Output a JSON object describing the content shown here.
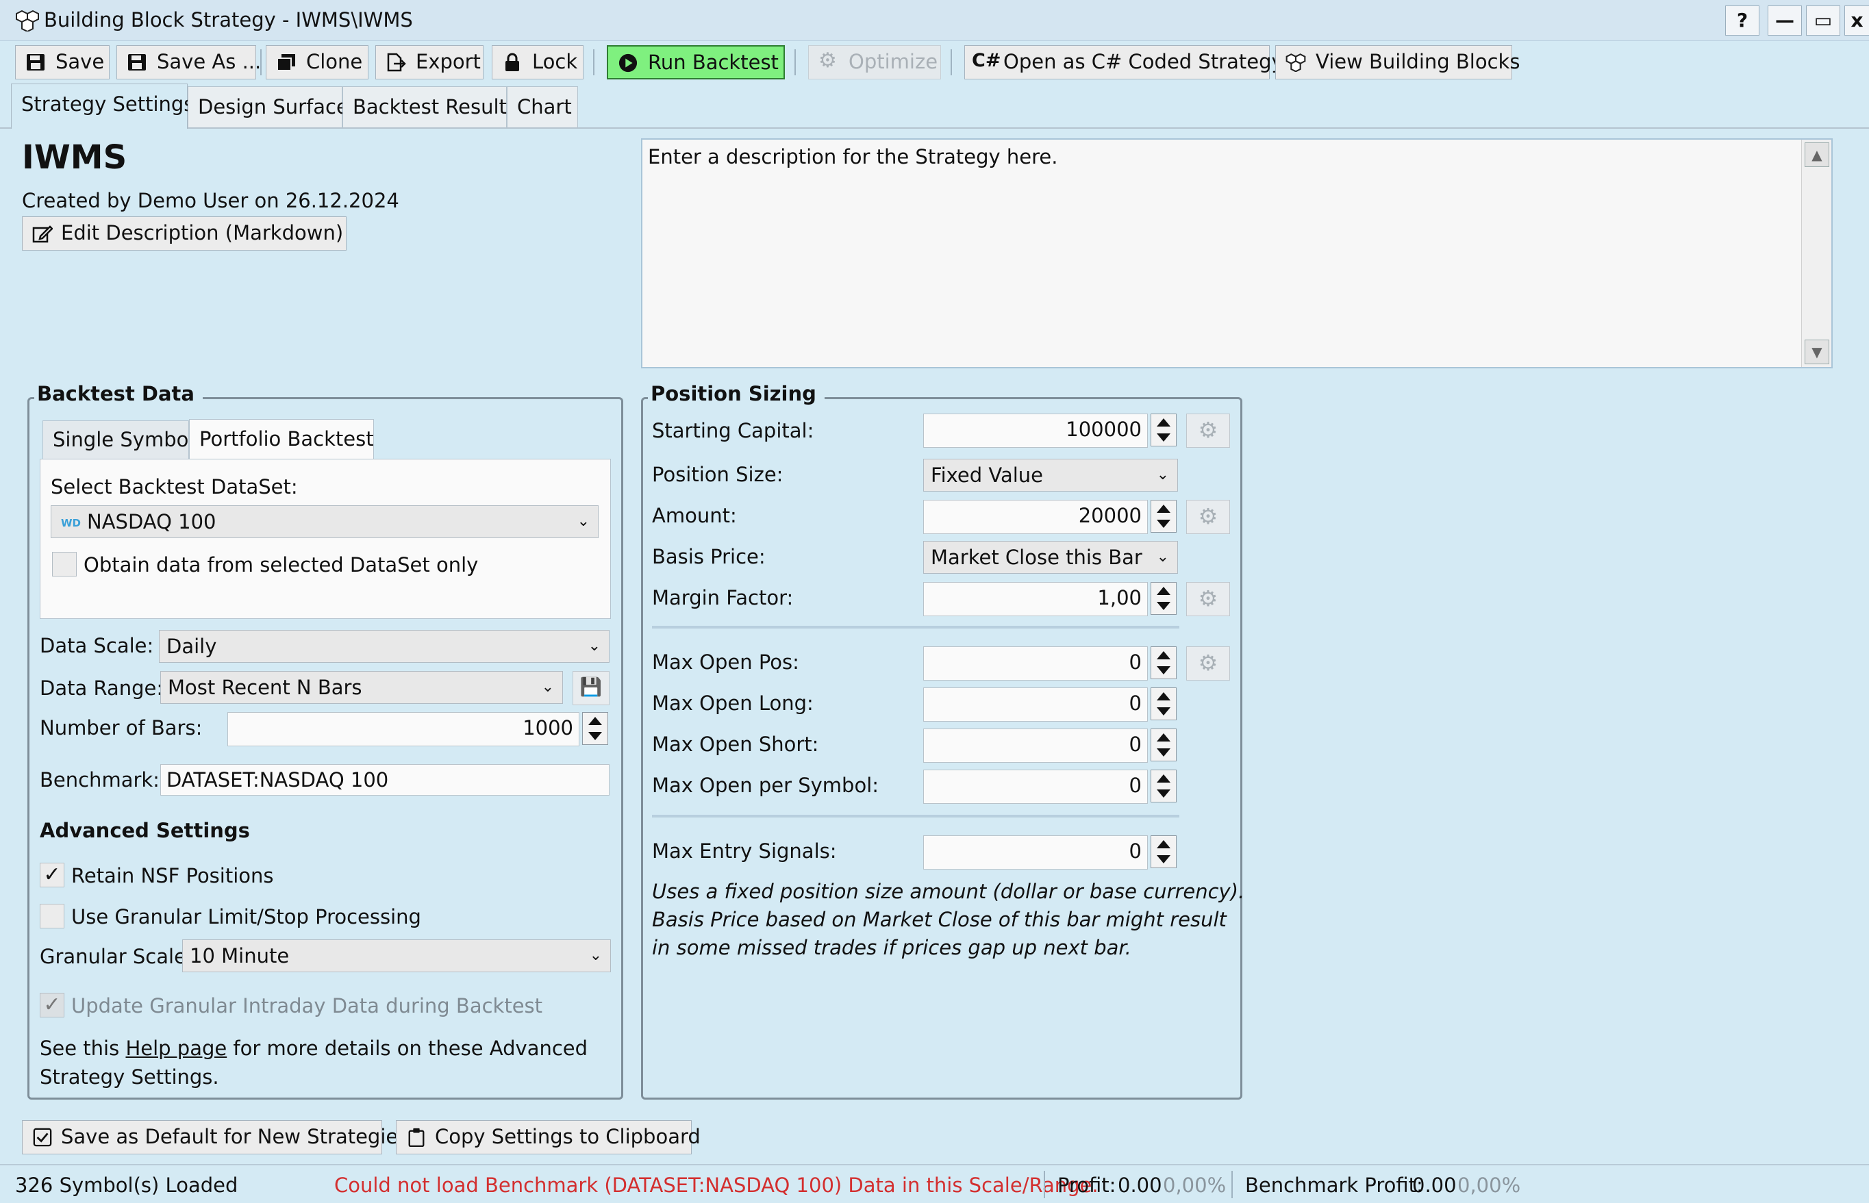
{
  "window": {
    "title": "Building Block Strategy - IWMS\\IWMS",
    "help": "?",
    "minimize": "—",
    "maximize": "▭",
    "close": "x"
  },
  "toolbar": {
    "save": "Save",
    "save_as": "Save As ...",
    "clone": "Clone",
    "export": "Export",
    "lock": "Lock",
    "run_backtest": "Run Backtest",
    "optimize": "Optimize",
    "open_csharp": "Open as C# Coded Strategy",
    "view_blocks": "View Building Blocks"
  },
  "tabs": [
    "Strategy Settings",
    "Design Surface",
    "Backtest Results",
    "Chart"
  ],
  "strategy": {
    "name": "IWMS",
    "created": "Created by Demo User on 26.12.2024",
    "edit_description": "Edit Description (Markdown)",
    "description": "Enter a description for the Strategy here."
  },
  "backtest_data": {
    "title": "Backtest Data",
    "subtabs": [
      "Single Symbol",
      "Portfolio Backtest"
    ],
    "select_label": "Select Backtest DataSet:",
    "dataset_badge": "WD",
    "dataset": "NASDAQ 100",
    "obtain_only": "Obtain data from selected DataSet only",
    "data_scale_label": "Data Scale:",
    "data_scale": "Daily",
    "data_range_label": "Data Range:",
    "data_range": "Most Recent N Bars",
    "num_bars_label": "Number of Bars:",
    "num_bars": "1000",
    "benchmark_label": "Benchmark:",
    "benchmark": "DATASET:NASDAQ 100"
  },
  "advanced": {
    "title": "Advanced Settings",
    "retain_nsf": "Retain NSF Positions",
    "granular_limit": "Use Granular Limit/Stop Processing",
    "granular_scale_label": "Granular Scale",
    "granular_scale": "10 Minute",
    "update_granular": "Update Granular Intraday Data during Backtest",
    "help_prefix": "See this ",
    "help_link": "Help page",
    "help_suffix": " for more details on these Advanced",
    "help_line2": "Strategy Settings."
  },
  "position_sizing": {
    "title": "Position Sizing",
    "starting_capital_label": "Starting Capital:",
    "starting_capital": "100000",
    "position_size_label": "Position Size:",
    "position_size": "Fixed Value",
    "amount_label": "Amount:",
    "amount": "20000",
    "basis_price_label": "Basis Price:",
    "basis_price": "Market Close this Bar",
    "margin_factor_label": "Margin Factor:",
    "margin_factor": "1,00",
    "max_open_pos_label": "Max Open Pos:",
    "max_open_pos": "0",
    "max_open_long_label": "Max Open Long:",
    "max_open_long": "0",
    "max_open_short_label": "Max Open Short:",
    "max_open_short": "0",
    "max_open_symbol_label": "Max Open per Symbol:",
    "max_open_symbol": "0",
    "max_entry_label": "Max Entry Signals:",
    "max_entry": "0",
    "note_line1": "Uses a fixed position size amount (dollar or base currency).",
    "note_line2": "Basis Price based on Market Close of this bar might result",
    "note_line3": "in some missed trades if prices gap up next bar."
  },
  "bottom_buttons": {
    "save_default": "Save as Default for New Strategies",
    "copy_settings": "Copy Settings to Clipboard"
  },
  "status": {
    "symbols_loaded": "326 Symbol(s) Loaded",
    "error": "Could not load Benchmark (DATASET:NASDAQ 100) Data in this Scale/Range.",
    "profit_label": "Profit:",
    "profit_value": "0.00",
    "profit_pct": "0,00%",
    "bench_label": "Benchmark Profit:",
    "bench_value": "0.00",
    "bench_pct": "0,00%"
  },
  "colors": {
    "background": "#d4eaf4",
    "run_button": "#7ff07f",
    "error_text": "#d32f2f",
    "group_border": "#7e8e99"
  }
}
